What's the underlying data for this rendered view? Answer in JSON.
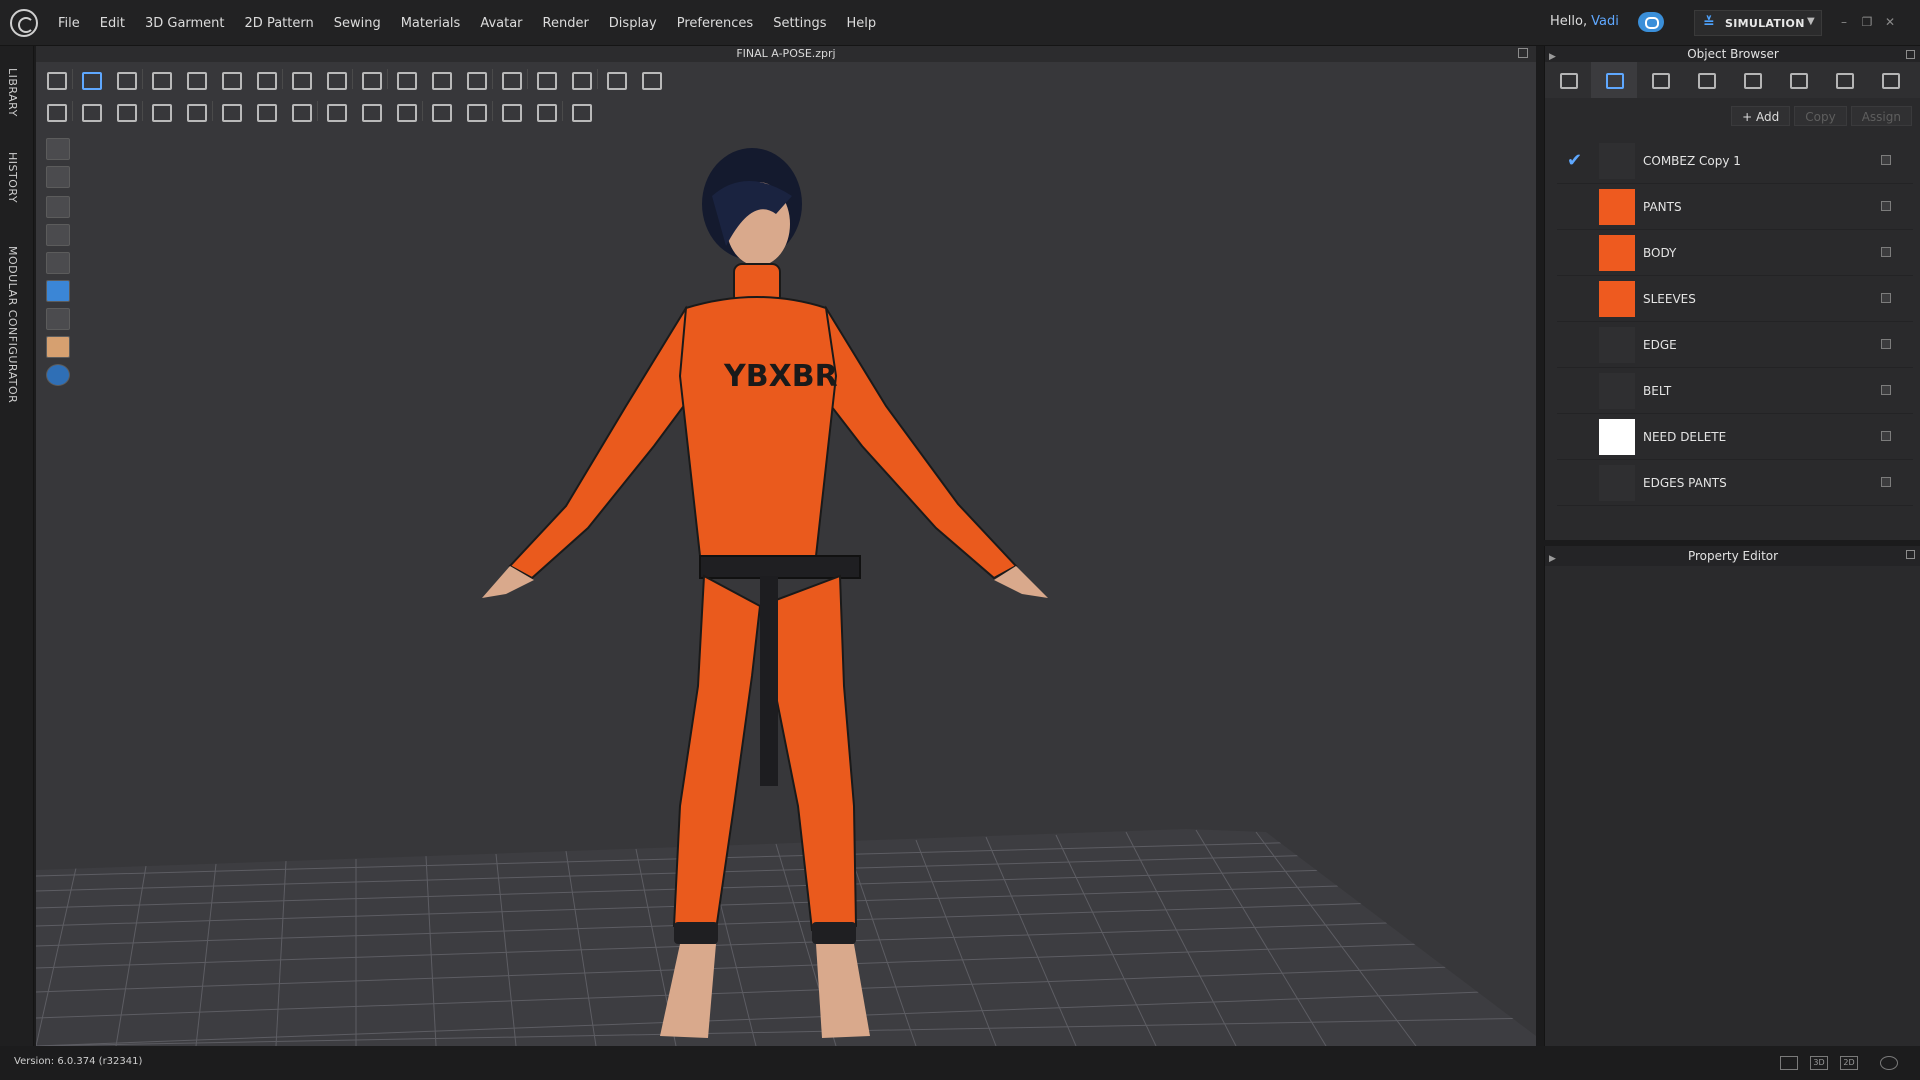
{
  "menu": [
    "File",
    "Edit",
    "3D Garment",
    "2D Pattern",
    "Sewing",
    "Materials",
    "Avatar",
    "Render",
    "Display",
    "Preferences",
    "Settings",
    "Help"
  ],
  "greeting": {
    "hello": "Hello,",
    "user": "Vadi"
  },
  "mode": {
    "label": "SIMULATION"
  },
  "left_tabs": [
    "LIBRARY",
    "HISTORY",
    "MODULAR CONFIGURATOR"
  ],
  "viewport": {
    "file_title": "FINAL A-POSE.zprj"
  },
  "object_browser": {
    "title": "Object Browser",
    "actions": [
      {
        "label": "+ Add",
        "enabled": true
      },
      {
        "label": "Copy",
        "enabled": false
      },
      {
        "label": "Assign",
        "enabled": false
      }
    ],
    "materials": [
      {
        "name": "COMBEZ Copy 1",
        "color": "#2f2f31",
        "checked": true
      },
      {
        "name": "PANTS",
        "color": "#ee5a1f",
        "checked": false
      },
      {
        "name": "BODY",
        "color": "#ee5a1f",
        "checked": false
      },
      {
        "name": "SLEEVES",
        "color": "#ee5a1f",
        "checked": false
      },
      {
        "name": "EDGE",
        "color": "#2f2f31",
        "checked": false
      },
      {
        "name": "BELT",
        "color": "#2f2f31",
        "checked": false
      },
      {
        "name": "NEED DELETE",
        "color": "#ffffff",
        "checked": false
      },
      {
        "name": "EDGES PANTS",
        "color": "#2f2f31",
        "checked": false
      }
    ]
  },
  "property_editor": {
    "title": "Property Editor"
  },
  "status": {
    "version": "Version: 6.0.374 (r32341)"
  },
  "view_buttons": [
    "",
    "3D",
    "2D",
    ""
  ],
  "colors": {
    "accent": "#5fa8ff",
    "garment": "#ee5a1f",
    "viewport_bg": "#37373a"
  }
}
